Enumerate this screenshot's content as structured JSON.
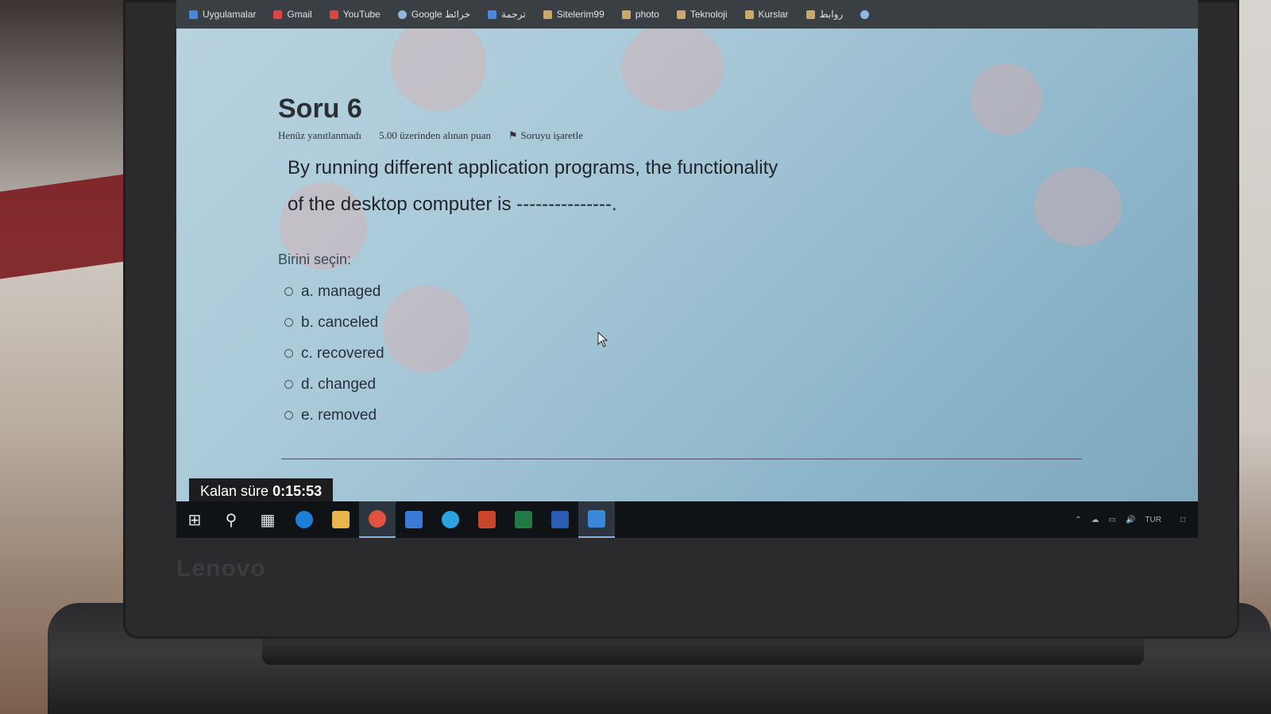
{
  "bookmarks": [
    {
      "label": "Uygulamalar",
      "icon": "apps-icon"
    },
    {
      "label": "Gmail",
      "icon": "gmail-icon"
    },
    {
      "label": "YouTube",
      "icon": "youtube-icon"
    },
    {
      "label": "Google خرائط",
      "icon": "google-maps-icon"
    },
    {
      "label": "ترجمة",
      "icon": "translate-icon"
    },
    {
      "label": "Sitelerim99",
      "icon": "folder-icon"
    },
    {
      "label": "photo",
      "icon": "folder-icon"
    },
    {
      "label": "Teknoloji",
      "icon": "folder-icon"
    },
    {
      "label": "Kurslar",
      "icon": "folder-icon"
    },
    {
      "label": "روابط",
      "icon": "folder-icon"
    }
  ],
  "question": {
    "title": "Soru 6",
    "status": "Henüz yanıtlanmadı",
    "points": "5.00 üzerinden alınan puan",
    "flag_label": "Soruyu işaretle",
    "text_line1": "By running different application programs, the functionality",
    "text_line2": "of the desktop computer is ---------------.",
    "prompt": "Birini seçin:",
    "options": [
      {
        "label": "a. managed"
      },
      {
        "label": "b. canceled"
      },
      {
        "label": "c. recovered"
      },
      {
        "label": "d. changed"
      },
      {
        "label": "e. removed"
      }
    ]
  },
  "timer": {
    "label": "Kalan süre",
    "value": "0:15:53"
  },
  "taskbar": {
    "apps": [
      {
        "name": "start-icon"
      },
      {
        "name": "search-icon"
      },
      {
        "name": "task-view-icon"
      },
      {
        "name": "edge-icon",
        "color": "#1e7fd6"
      },
      {
        "name": "file-explorer-icon",
        "color": "#e8b64a"
      },
      {
        "name": "chrome-icon",
        "color": "#e0533f"
      },
      {
        "name": "store-icon",
        "color": "#3b7ad6"
      },
      {
        "name": "telegram-icon",
        "color": "#2aa3e0"
      },
      {
        "name": "powerpoint-icon",
        "color": "#c9452c"
      },
      {
        "name": "excel-icon",
        "color": "#1f7a46"
      },
      {
        "name": "word-icon",
        "color": "#2a5db3"
      },
      {
        "name": "camera-app-icon",
        "color": "#3a86d8"
      }
    ],
    "language": "TUR"
  },
  "brand": "Lenovo"
}
